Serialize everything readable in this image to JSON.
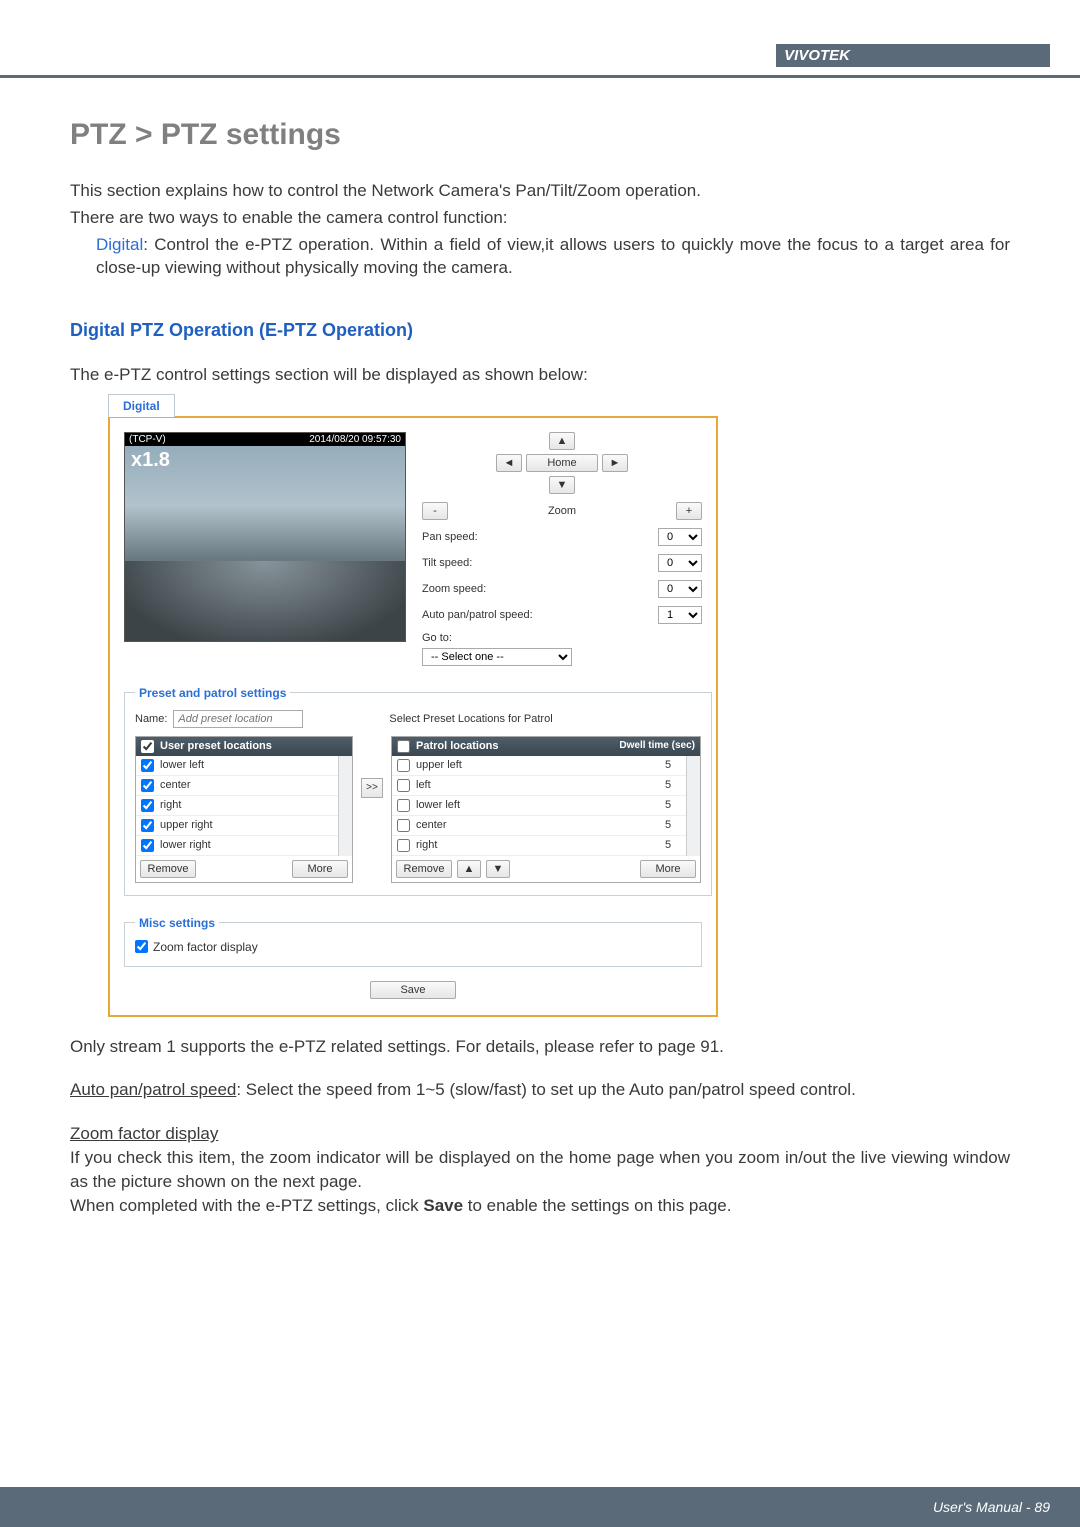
{
  "header": {
    "brand": "VIVOTEK"
  },
  "footer": {
    "label": "User's Manual - ",
    "page": "89"
  },
  "title": "PTZ > PTZ settings",
  "intro1": "This section explains how to control the Network Camera's Pan/Tilt/Zoom operation.",
  "intro2": "There are two ways to enable the camera control function:",
  "digitalWord": "Digital",
  "digitalDesc": ": Control the e-PTZ operation. Within a field of view,it allows users to quickly move the focus to a target area for close-up viewing without physically moving the camera.",
  "section2": "Digital PTZ Operation (E-PTZ Operation)",
  "section2body": "The e-PTZ control settings section will be displayed as shown below:",
  "ui": {
    "tab": "Digital",
    "video": {
      "title": "(TCP-V)",
      "timestamp": "2014/08/20 09:57:30",
      "zoom": "x1.8"
    },
    "nav": {
      "home": "Home",
      "zoom": "Zoom"
    },
    "speeds": {
      "pan": {
        "label": "Pan speed:",
        "value": "0"
      },
      "tilt": {
        "label": "Tilt speed:",
        "value": "0"
      },
      "zoom": {
        "label": "Zoom speed:",
        "value": "0"
      },
      "auto": {
        "label": "Auto pan/patrol speed:",
        "value": "1"
      }
    },
    "goto": {
      "label": "Go to:",
      "value": "-- Select one --"
    },
    "preset": {
      "legend": "Preset and patrol settings",
      "nameLabel": "Name:",
      "namePlaceholder": "Add preset location",
      "selectLabel": "Select Preset Locations for Patrol",
      "leftHeader": "User preset locations",
      "leftItems": [
        "lower left",
        "center",
        "right",
        "upper right",
        "lower right"
      ],
      "rightHeader": "Patrol locations",
      "dwellHeader": "Dwell time (sec)",
      "rightItems": [
        {
          "name": "upper left",
          "dwell": "5"
        },
        {
          "name": "left",
          "dwell": "5"
        },
        {
          "name": "lower left",
          "dwell": "5"
        },
        {
          "name": "center",
          "dwell": "5"
        },
        {
          "name": "right",
          "dwell": "5"
        }
      ],
      "removeBtn": "Remove",
      "moreBtn": "More"
    },
    "misc": {
      "legend": "Misc settings",
      "zoomFactor": "Zoom factor display"
    },
    "save": "Save"
  },
  "after1": "Only stream 1 supports the e-PTZ related settings. For details, please refer to page 91.",
  "autoLabel": "Auto pan/patrol speed",
  "autoBody": ": Select the speed from 1~5 (slow/fast) to set up the Auto pan/patrol speed control.",
  "zfHead": "Zoom factor display",
  "zfBody1": "If you check this item, the zoom indicator will be displayed on the home page when you zoom in/out the live viewing window as the picture shown on the next page.",
  "zfBody2a": "When completed with the e-PTZ settings, click ",
  "saveWord": "Save",
  "zfBody2b": " to enable the settings on this page."
}
